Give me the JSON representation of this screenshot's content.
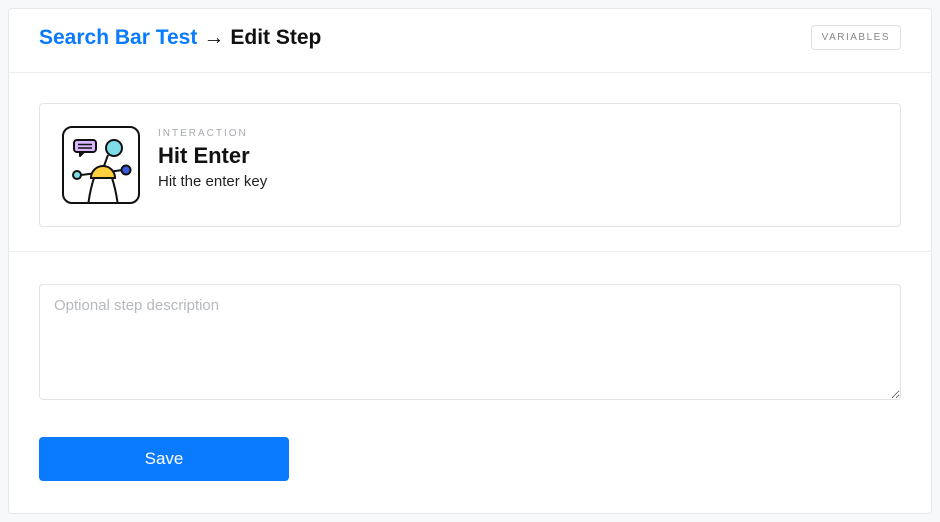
{
  "header": {
    "breadcrumb_root": "Search Bar Test",
    "breadcrumb_arrow": "→",
    "breadcrumb_current": "Edit Step",
    "variables_label": "VARIABLES"
  },
  "step": {
    "category": "INTERACTION",
    "title": "Hit Enter",
    "description": "Hit the enter key"
  },
  "form": {
    "description_placeholder": "Optional step description",
    "description_value": "",
    "save_label": "Save"
  },
  "colors": {
    "accent": "#0a7bff"
  }
}
